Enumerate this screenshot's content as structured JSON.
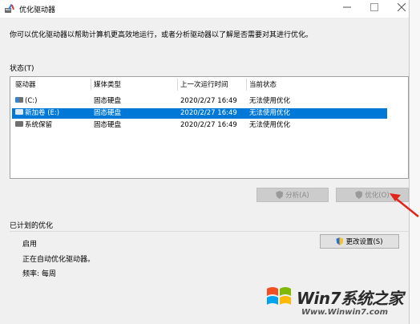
{
  "window": {
    "title": "优化驱动器"
  },
  "description": "你可以优化驱动器以帮助计算机更高效地运行，或者分析驱动器以了解是否需要对其进行优化。",
  "status_section": {
    "label": "状态(T)",
    "columns": [
      "驱动器",
      "媒体类型",
      "上一次运行时间",
      "当前状态"
    ],
    "rows": [
      {
        "drive": "(C:)",
        "media": "固态硬盘",
        "last_run": "2020/2/27 16:49",
        "status": "无法使用优化",
        "icon": "windows-drive-icon",
        "selected": false
      },
      {
        "drive": "新加卷 (E:)",
        "media": "固态硬盘",
        "last_run": "2020/2/27 16:49",
        "status": "无法使用优化",
        "icon": "drive-icon",
        "selected": true
      },
      {
        "drive": "系统保留",
        "media": "固态硬盘",
        "last_run": "2020/2/27 16:49",
        "status": "无法使用优化",
        "icon": "drive-icon",
        "selected": false
      }
    ]
  },
  "buttons": {
    "analyze": "分析(A)",
    "optimize": "优化(O)",
    "change_settings": "更改设置(S)"
  },
  "scheduled": {
    "label": "已计划的优化",
    "state": "启用",
    "message": "正在自动优化驱动器。",
    "frequency": "频率: 每周"
  },
  "watermark": {
    "brand": "Win7系统之家",
    "url": "Www.Winwin7.com"
  },
  "colors": {
    "selection": "#0078d7",
    "arrow": "#e2231a"
  }
}
